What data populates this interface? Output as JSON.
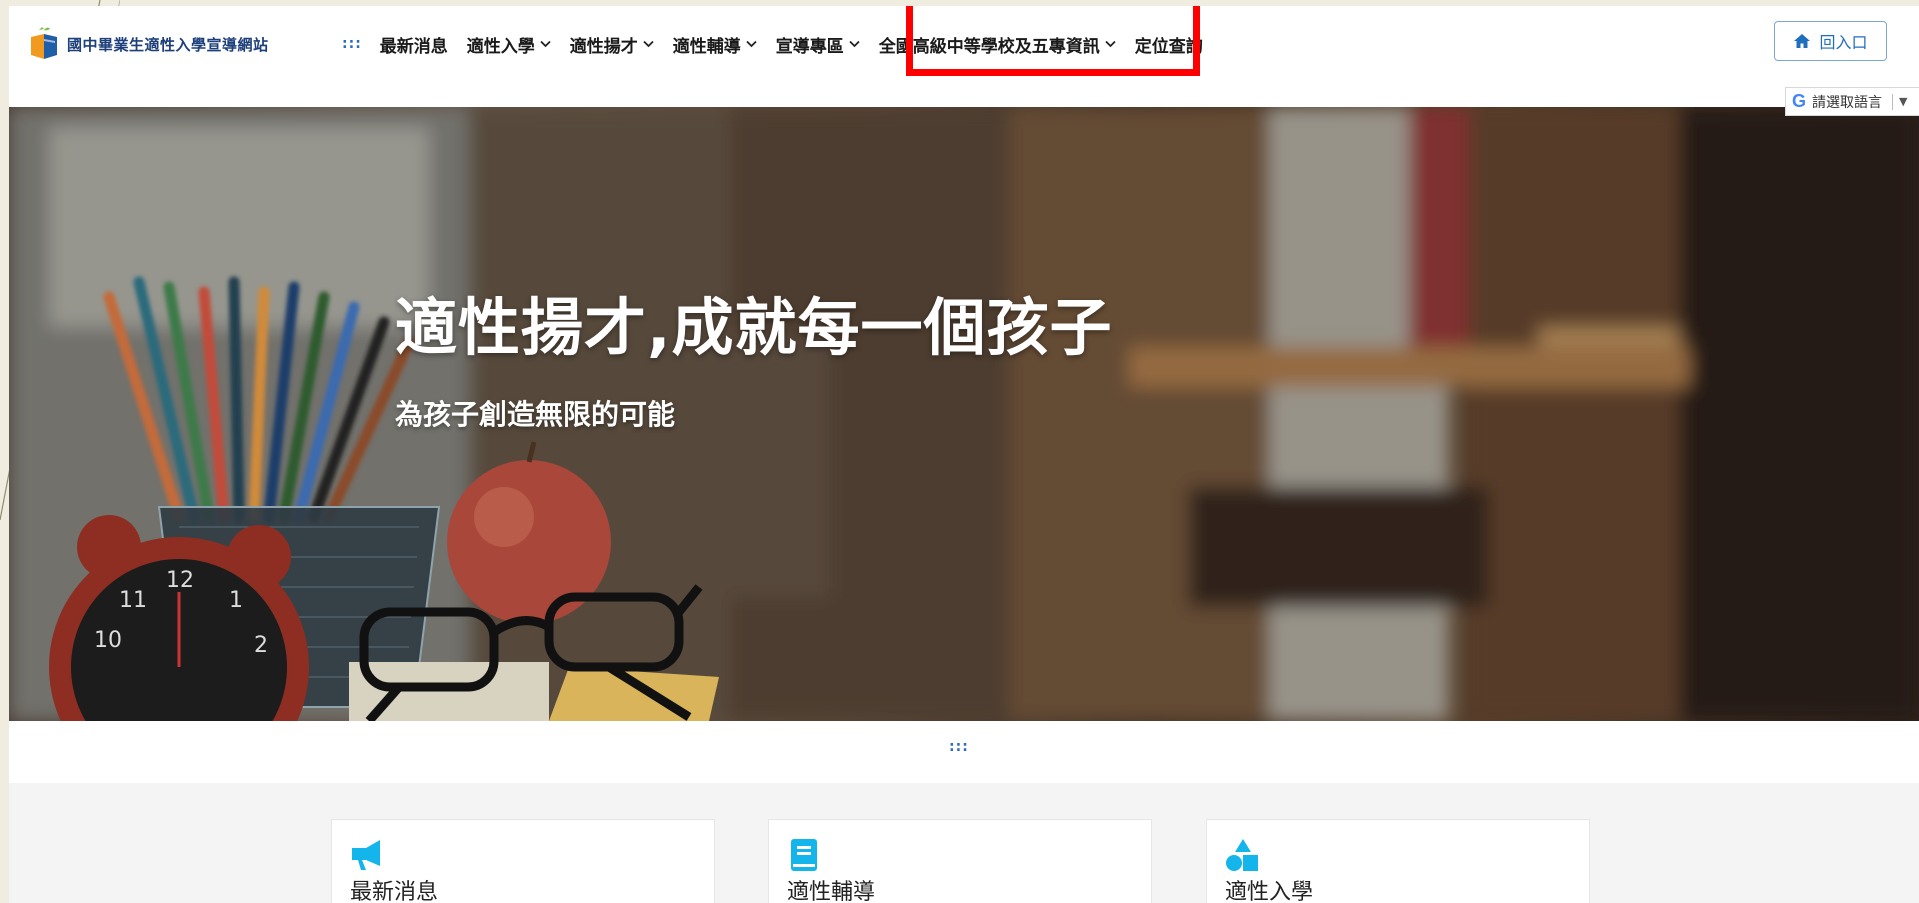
{
  "site": {
    "logo_text": "國中畢業生適性入學宣導網站"
  },
  "nav": {
    "dots": ":::",
    "items": [
      {
        "label": "最新消息",
        "dropdown": false
      },
      {
        "label": "適性入學",
        "dropdown": true
      },
      {
        "label": "適性揚才",
        "dropdown": true
      },
      {
        "label": "適性輔導",
        "dropdown": true
      },
      {
        "label": "宣導專區",
        "dropdown": true
      },
      {
        "label": "全國高級中等學校及五專資訊",
        "dropdown": true,
        "highlighted": true
      },
      {
        "label": "定位查詢",
        "dropdown": false
      }
    ]
  },
  "home_button": {
    "label": "回入口",
    "icon": "home-icon"
  },
  "language": {
    "label": "請選取語言",
    "icon": "google-g-icon"
  },
  "hero": {
    "title": "適性揚才,成就每一個孩子",
    "subtitle": "為孩子創造無限的可能"
  },
  "divider": {
    "dots": ":::"
  },
  "cards": [
    {
      "title": "最新消息",
      "icon": "megaphone-icon"
    },
    {
      "title": "適性輔導",
      "icon": "book-icon"
    },
    {
      "title": "適性入學",
      "icon": "shapes-icon"
    }
  ],
  "colors": {
    "accent": "#1f6fbf",
    "icon_blue": "#13b5ea",
    "highlight": "#ff0000"
  }
}
